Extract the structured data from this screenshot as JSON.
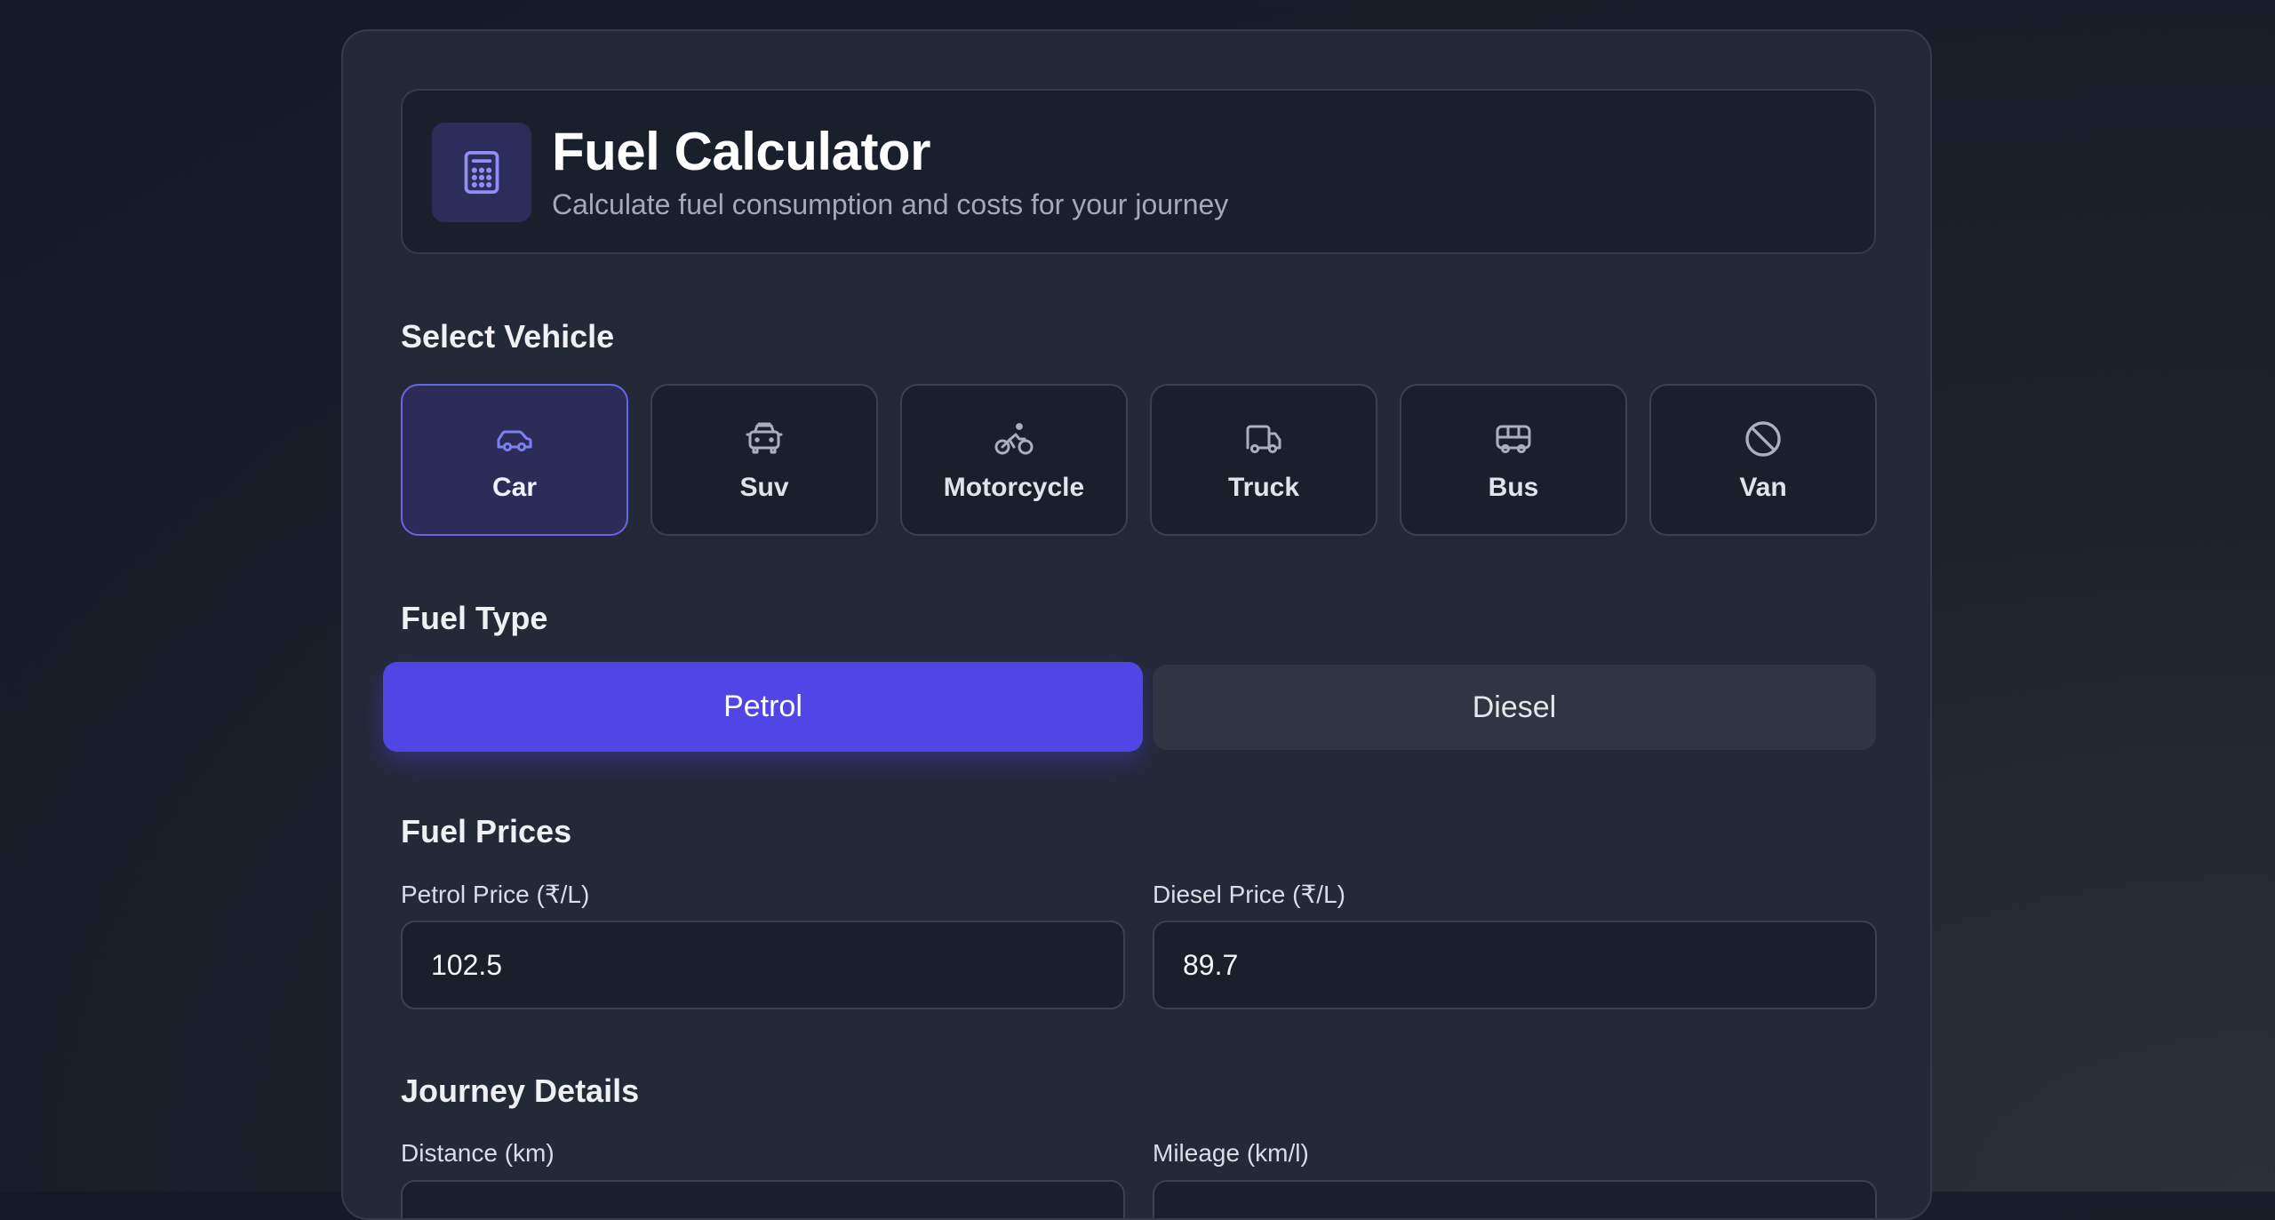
{
  "header": {
    "title": "Fuel Calculator",
    "subtitle": "Calculate fuel consumption and costs for your journey",
    "icon": "calculator-icon"
  },
  "vehicle_section": {
    "title": "Select Vehicle",
    "selected": "Car",
    "vehicles": [
      {
        "label": "Car",
        "icon": "car-icon"
      },
      {
        "label": "Suv",
        "icon": "suv-icon"
      },
      {
        "label": "Motorcycle",
        "icon": "motorcycle-icon"
      },
      {
        "label": "Truck",
        "icon": "truck-icon"
      },
      {
        "label": "Bus",
        "icon": "bus-icon"
      },
      {
        "label": "Van",
        "icon": "ban-icon"
      }
    ]
  },
  "fuel_type": {
    "title": "Fuel Type",
    "selected": "Petrol",
    "options": [
      "Petrol",
      "Diesel"
    ]
  },
  "fuel_prices": {
    "title": "Fuel Prices",
    "petrol_label": "Petrol Price (₹/L)",
    "petrol_value": "102.5",
    "diesel_label": "Diesel Price (₹/L)",
    "diesel_value": "89.7"
  },
  "journey": {
    "title": "Journey Details",
    "distance_label": "Distance (km)",
    "mileage_label": "Mileage (km/l)"
  },
  "colors": {
    "accent": "#4f46e5",
    "card_bg": "#232937",
    "panel_bg": "#1a1f2c",
    "selected_bg": "#2b2d58"
  }
}
